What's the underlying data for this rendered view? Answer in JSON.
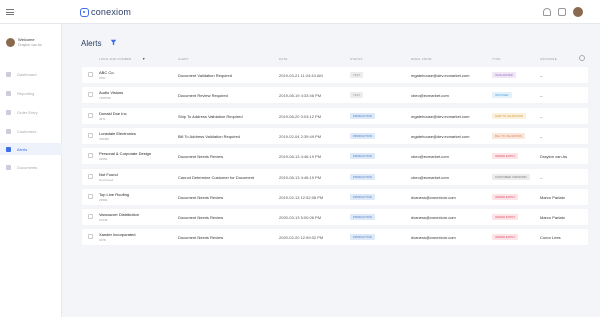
{
  "app": {
    "logo_text": "conexiom"
  },
  "sidebar": {
    "welcome_title": "Welcome",
    "welcome_name": "Drayton van As",
    "items": [
      {
        "label": "Dashboard",
        "icon": "dashboard-icon",
        "active": false
      },
      {
        "label": "Reporting",
        "icon": "reporting-icon",
        "active": false
      },
      {
        "label": "Order Entry",
        "icon": "order-entry-icon",
        "active": false
      },
      {
        "label": "Customers",
        "icon": "customers-icon",
        "active": false
      },
      {
        "label": "Alerts",
        "icon": "alerts-icon",
        "active": true
      },
      {
        "label": "Documents",
        "icon": "documents-icon",
        "active": false
      }
    ]
  },
  "page": {
    "title": "Alerts"
  },
  "table": {
    "columns": [
      "LOGO AND NUMBER",
      "ALERT",
      "DATE",
      "STATUS",
      "EMAIL FROM",
      "TYPE",
      "ASSIGNEE"
    ],
    "rows": [
      {
        "name": "ABC Co.",
        "number": "0707",
        "alert": "Document Validation Required",
        "date": "2019-03-21 11:24:43 AM",
        "status": "TEST",
        "email": "mgatehouse@dev.ecmarket.com",
        "type": "INVALIDATED",
        "type_bg": "#efe6f6",
        "type_color": "#9b6bbf",
        "assignee": "--"
      },
      {
        "name": "Audio Visions",
        "number": "7165796",
        "alert": "Document Review Required",
        "date": "2019-08-19 4:33:46 PM",
        "status": "TEST",
        "email": "cbeo@ecmarket.com",
        "type": "INVOICED",
        "type_bg": "#e3f1fb",
        "type_color": "#4a9ad6",
        "assignee": "--"
      },
      {
        "name": "Donald Doe Inc",
        "number": "4671",
        "alert": "Ship To Address Validation Required",
        "date": "2019-08-20 3:03:12 PM",
        "status": "PRODUCTION",
        "email": "mgatehouse@dev.ecmarket.com",
        "type": "SHIP TO VALIDATION",
        "type_bg": "#fbf0dc",
        "type_color": "#d09a3e",
        "assignee": "--"
      },
      {
        "name": "Lonsdale Electronics",
        "number": "700450",
        "alert": "Bill To Address Validation Required",
        "date": "2019-02-04 2:39:49 PM",
        "status": "PRODUCTION",
        "email": "mgatehouse@dev.ecmarket.com",
        "type": "BILL TO VALIDATION",
        "type_bg": "#fbe6dc",
        "type_color": "#d9825a",
        "assignee": "--"
      },
      {
        "name": "Personal & Corporate Design",
        "number": "23591",
        "alert": "Document Needs Review",
        "date": "2019-08-13 4:46:19 PM",
        "status": "PRODUCTION",
        "email": "cbeo@ecmarket.com",
        "type": "ORDER ENTRY",
        "type_bg": "#fbe3e6",
        "type_color": "#d9566a",
        "assignee": "Drayton van As"
      },
      {
        "name": "Not Found",
        "number": "Not Found",
        "alert": "Cannot Determine Customer for Document",
        "date": "2019-08-13 4:46:19 PM",
        "status": "PRODUCTION",
        "email": "cbeo@ecmarket.com",
        "type": "CUSTOMER UNKNOWN",
        "type_bg": "#ececec",
        "type_color": "#777777",
        "assignee": "--"
      },
      {
        "name": "Top Line Roofing",
        "number": "23500",
        "alert": "Document Needs Review",
        "date": "2019-02-13 12:52:08 PM",
        "status": "PRODUCTION",
        "email": "dvaness@conexiom.com",
        "type": "ORDER ENTRY",
        "type_bg": "#fbe3e6",
        "type_color": "#d9566a",
        "assignee": "Marco Parlato"
      },
      {
        "name": "Vancouver Distribution",
        "number": "37446",
        "alert": "Document Needs Review",
        "date": "2020-03-13 5:00:06 PM",
        "status": "PRODUCTION",
        "email": "dvaness@conexiom.com",
        "type": "ORDER ENTRY",
        "type_bg": "#fbe3e6",
        "type_color": "#d9566a",
        "assignee": "Marco Parlato"
      },
      {
        "name": "Xander Incorporated",
        "number": "3178",
        "alert": "Document Needs Review",
        "date": "2020-02-20 12:59:02 PM",
        "status": "PRODUCTION",
        "email": "dvaness@conexiom.com",
        "type": "ORDER ENTRY",
        "type_bg": "#fbe3e6",
        "type_color": "#d9566a",
        "assignee": "Conor Lees"
      }
    ]
  }
}
